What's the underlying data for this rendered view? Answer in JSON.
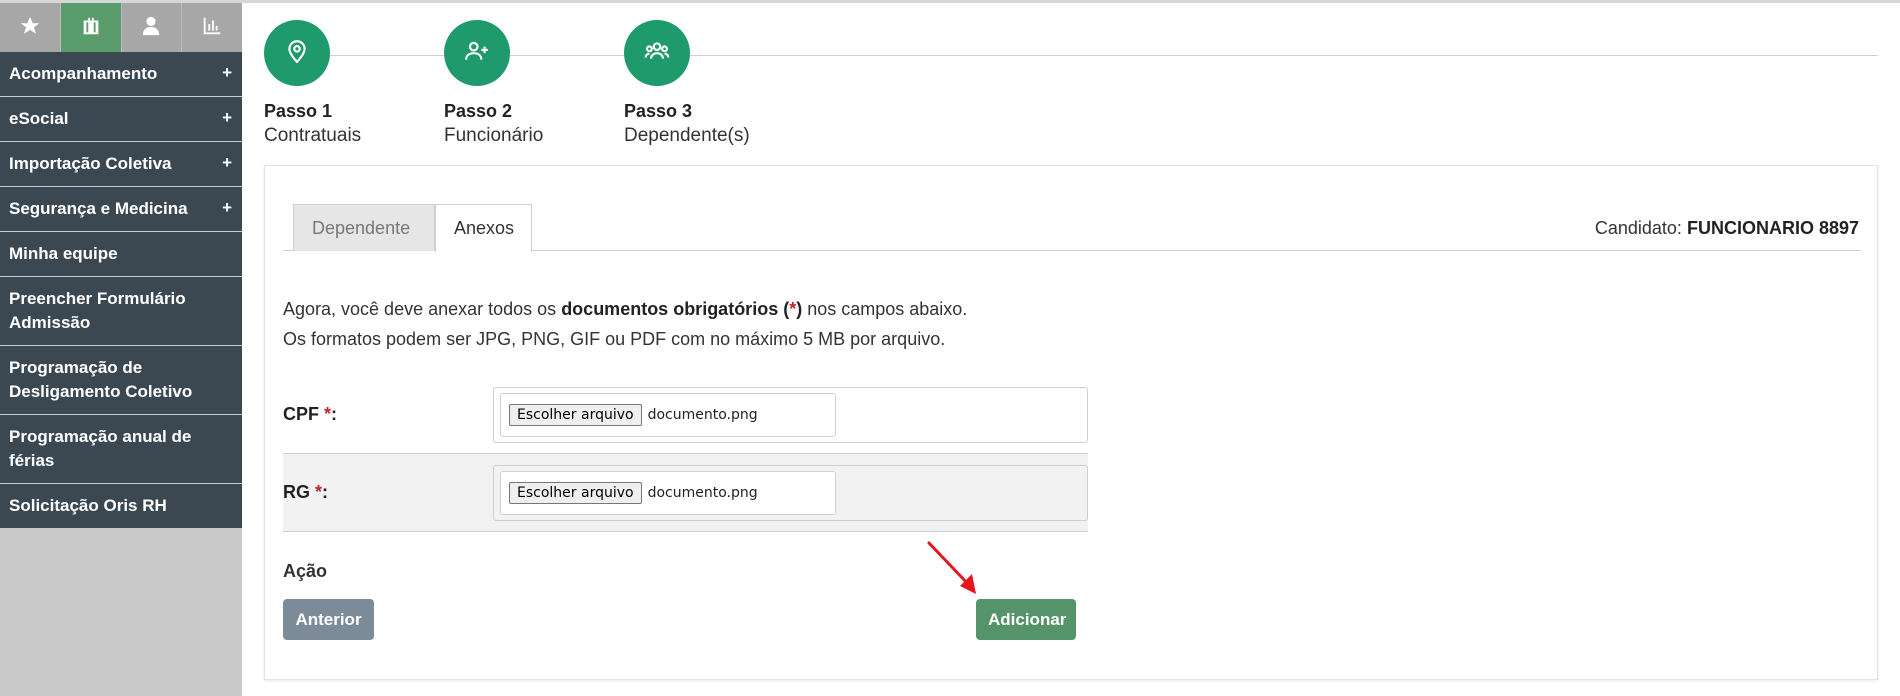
{
  "sidebar": {
    "icon_tabs": [
      {
        "icon": "star-icon",
        "active": false
      },
      {
        "icon": "briefcase-icon",
        "active": true
      },
      {
        "icon": "user-icon",
        "active": false
      },
      {
        "icon": "bar-chart-icon",
        "active": false
      }
    ],
    "items": [
      {
        "label": "Acompanhamento",
        "expandable": "+"
      },
      {
        "label": "eSocial",
        "expandable": "+"
      },
      {
        "label": "Importação Coletiva",
        "expandable": "+"
      },
      {
        "label": "Segurança e Medicina",
        "expandable": "+"
      },
      {
        "label": "Minha equipe"
      },
      {
        "label": "Preencher Formulário Admissão"
      },
      {
        "label": "Programação de Desligamento Coletivo"
      },
      {
        "label": "Programação anual de férias"
      },
      {
        "label": "Solicitação Oris RH"
      }
    ]
  },
  "stepper": {
    "steps": [
      {
        "title": "Passo 1",
        "subtitle": "Contratuais",
        "icon": "map-pin-icon"
      },
      {
        "title": "Passo 2",
        "subtitle": "Funcionário",
        "icon": "user-plus-icon"
      },
      {
        "title": "Passo 3",
        "subtitle": "Dependente(s)",
        "icon": "group-icon"
      }
    ]
  },
  "panel": {
    "tabs": [
      {
        "label": "Dependente",
        "active": false
      },
      {
        "label": "Anexos",
        "active": true
      }
    ],
    "candidate_label": "Candidato:",
    "candidate_name": "FUNCIONARIO 8897",
    "intro_line1_a": "Agora, você deve anexar todos os ",
    "intro_line1_bold": "documentos obrigatórios (",
    "intro_line1_star": "*",
    "intro_line1_bold_end": ")",
    "intro_line1_b": " nos campos abaixo.",
    "intro_line2": "Os formatos podem ser JPG, PNG, GIF ou PDF com no máximo 5 MB por arquivo.",
    "fields": [
      {
        "label": "CPF",
        "required_mark": "*",
        "suffix": ":",
        "button_label": "Escolher arquivo",
        "file_name": "documento.png"
      },
      {
        "label": "RG",
        "required_mark": "*",
        "suffix": ":",
        "button_label": "Escolher arquivo",
        "file_name": "documento.png"
      }
    ],
    "action_label": "Ação",
    "prev_button": "Anterior",
    "add_button": "Adicionar"
  },
  "colors": {
    "sidebar_item_bg": "#3b4852",
    "step_green": "#1f9a6d",
    "add_button": "#55946a",
    "prev_button": "#7d8b99",
    "required": "#c0232c",
    "annotation_arrow": "#e5161b"
  }
}
